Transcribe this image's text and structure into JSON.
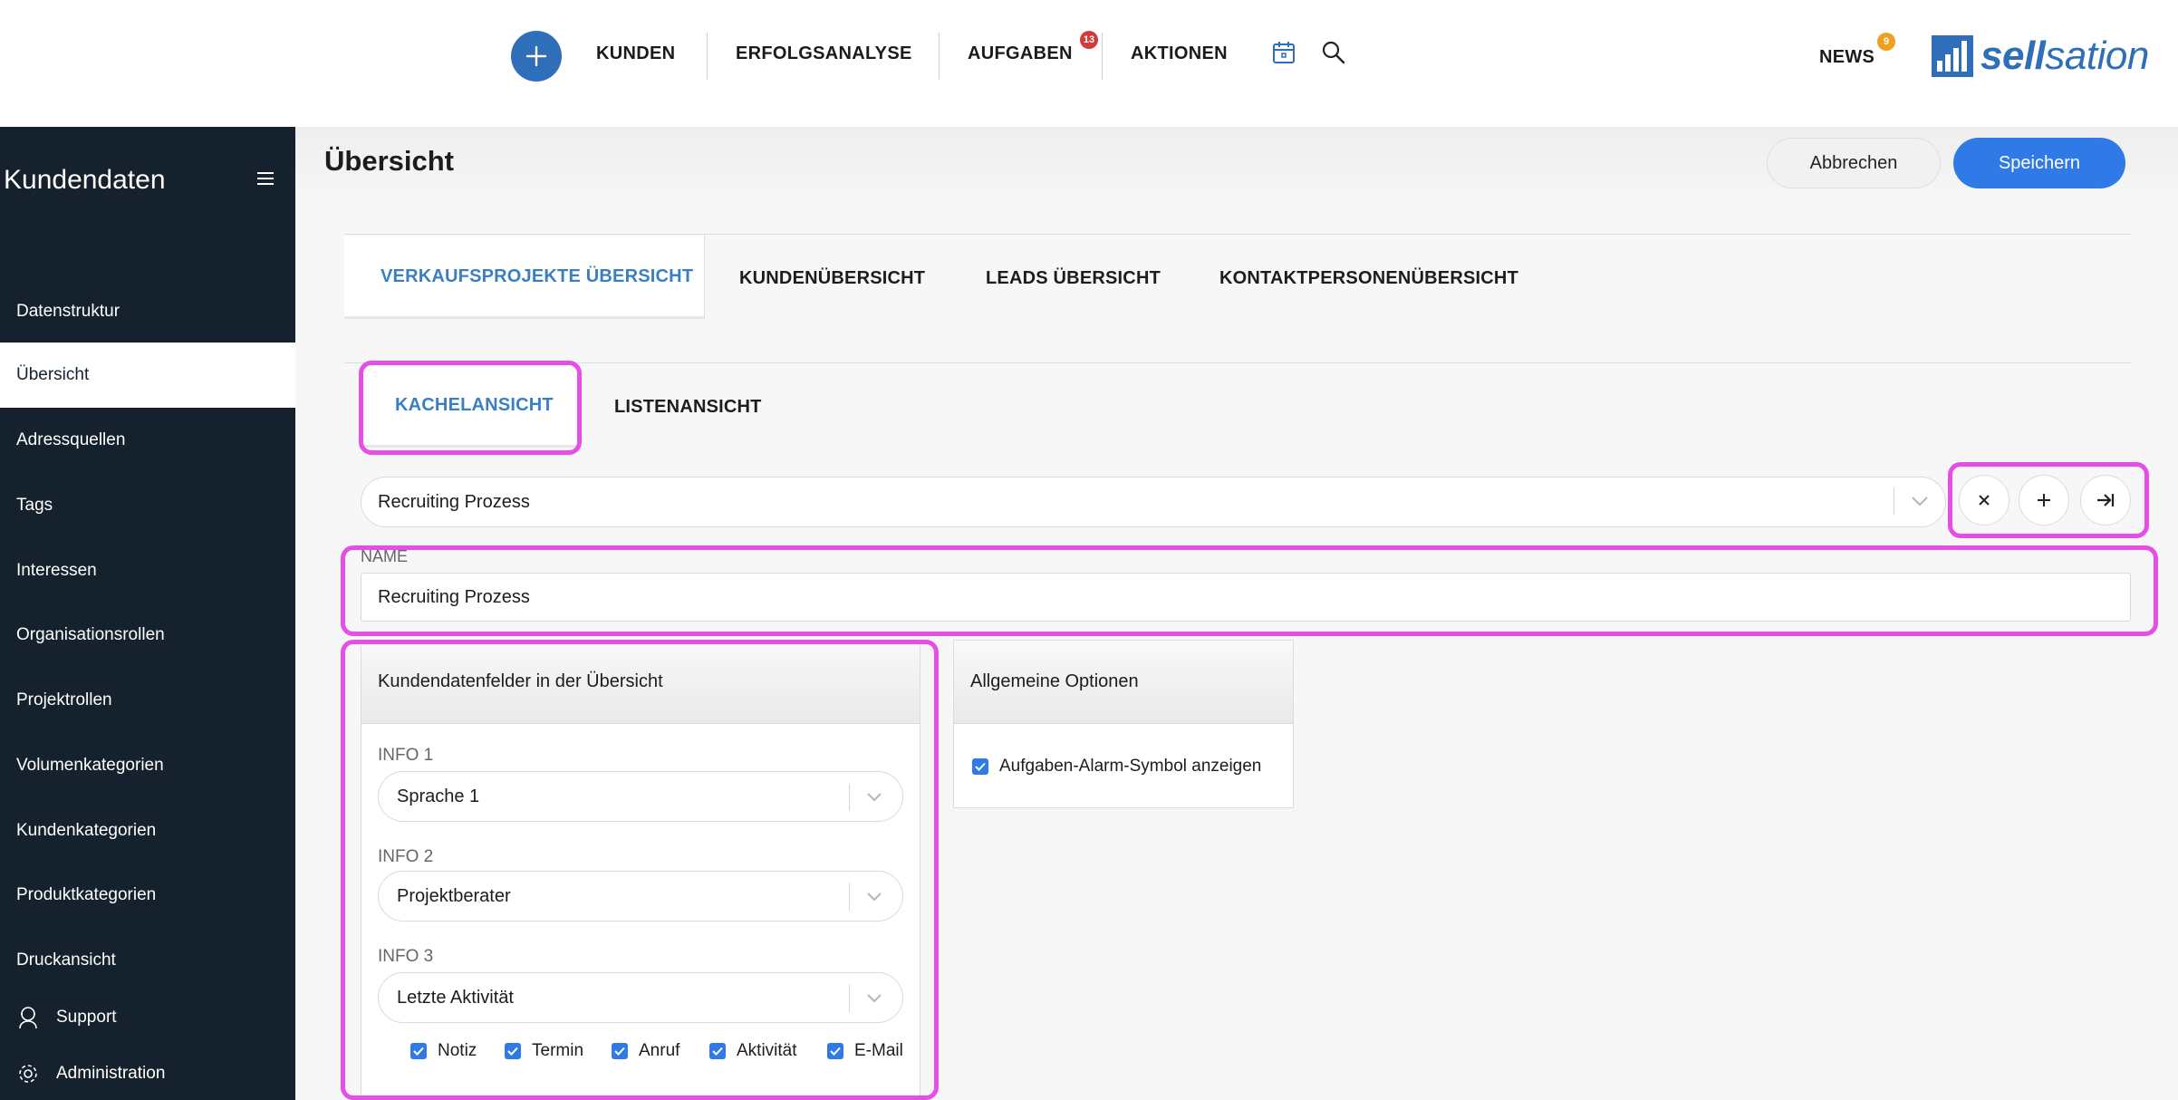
{
  "topnav": {
    "items": [
      "KUNDEN",
      "ERFOLGSANALYSE",
      "AUFGABEN",
      "AKTIONEN"
    ],
    "aufgaben_badge": "13",
    "news_label": "NEWS",
    "news_badge": "9",
    "logo_text_bold": "sell",
    "logo_text_light": "sation",
    "icons": [
      "plus-icon",
      "calendar-icon",
      "search-icon"
    ]
  },
  "sidebar": {
    "title": "Kundendaten",
    "items": [
      "Datenstruktur",
      "Übersicht",
      "Adressquellen",
      "Tags",
      "Interessen",
      "Organisationsrollen",
      "Projektrollen",
      "Volumenkategorien",
      "Kundenkategorien",
      "Produktkategorien",
      "Druckansicht"
    ],
    "active": "Übersicht",
    "bottom": [
      "Support",
      "Administration"
    ]
  },
  "header": {
    "title": "Übersicht",
    "cancel": "Abbrechen",
    "save": "Speichern"
  },
  "tabs": [
    "VERKAUFSPROJEKTE ÜBERSICHT",
    "KUNDENÜBERSICHT",
    "LEADS ÜBERSICHT",
    "KONTAKTPERSONENÜBERSICHT"
  ],
  "subtabs": [
    "KACHELANSICHT",
    "LISTENANSICHT"
  ],
  "view_select": {
    "value": "Recruiting Prozess"
  },
  "name_field": {
    "label": "NAME",
    "value": "Recruiting Prozess"
  },
  "fields_panel": {
    "title": "Kundendatenfelder in der Übersicht",
    "info": [
      {
        "label": "INFO 1",
        "value": "Sprache 1"
      },
      {
        "label": "INFO 2",
        "value": "Projektberater"
      },
      {
        "label": "INFO 3",
        "value": "Letzte Aktivität"
      }
    ],
    "checkboxes": [
      "Notiz",
      "Termin",
      "Anruf",
      "Aktivität",
      "E-Mail"
    ]
  },
  "options_panel": {
    "title": "Allgemeine Optionen",
    "checkbox": "Aufgaben-Alarm-Symbol anzeigen"
  },
  "colors": {
    "accent": "#2f7ae6",
    "sidebar": "#15212c",
    "highlight": "#e64ee8",
    "active_tab": "#3a7fc4"
  }
}
